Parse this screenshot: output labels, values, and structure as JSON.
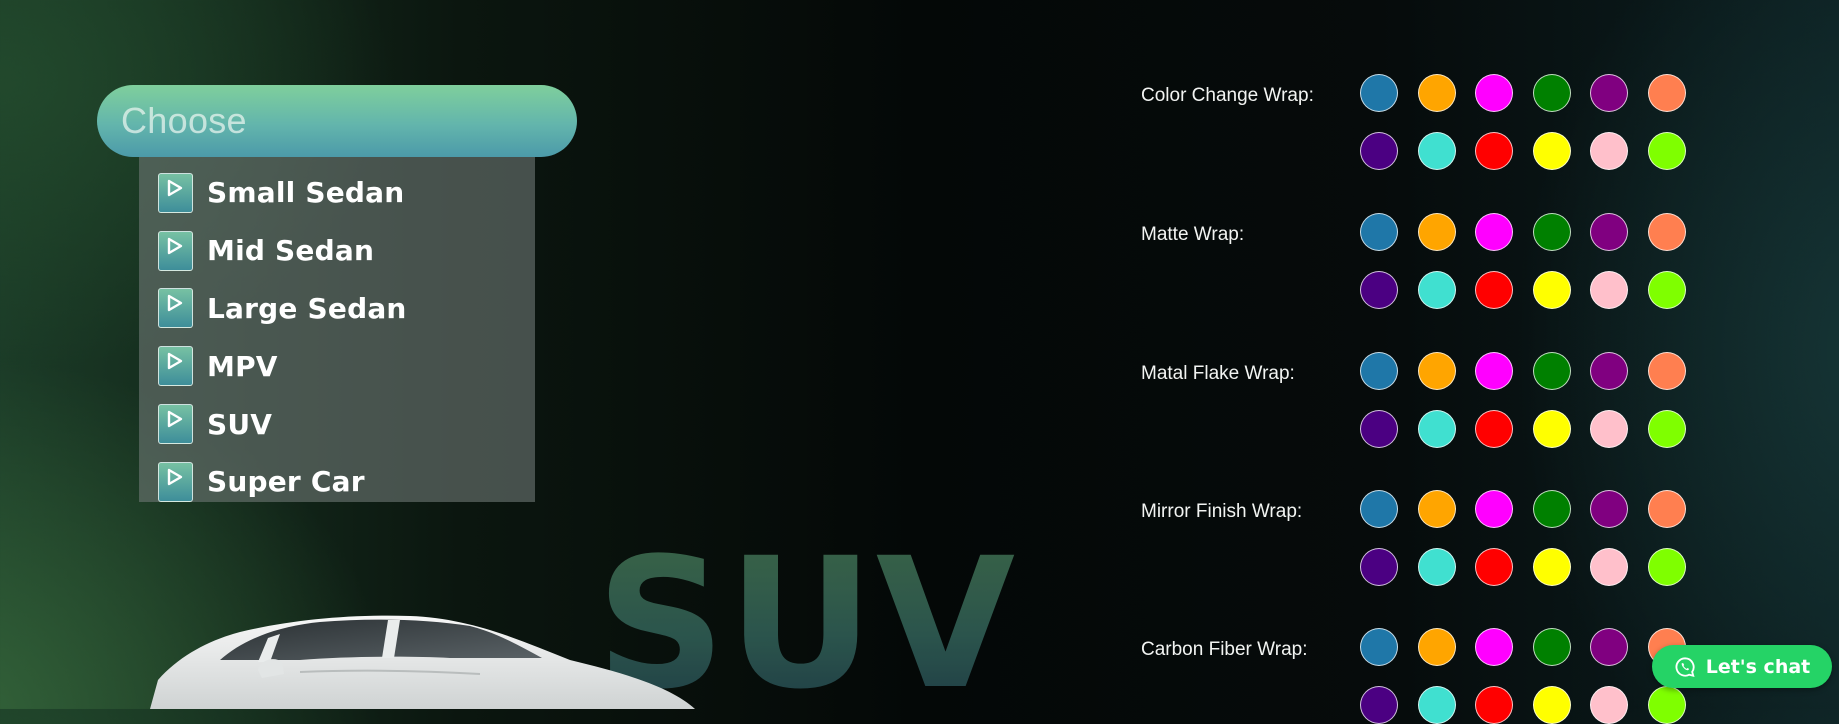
{
  "dropdown": {
    "placeholder": "Choose",
    "items": [
      {
        "label": "Small Sedan"
      },
      {
        "label": "Mid Sedan"
      },
      {
        "label": "Large Sedan"
      },
      {
        "label": "MPV"
      },
      {
        "label": "SUV"
      },
      {
        "label": "Super Car"
      }
    ],
    "item_icon": "play-icon"
  },
  "hero": {
    "big_label": "SUV"
  },
  "wraps": [
    {
      "label": "Color Change Wrap:"
    },
    {
      "label": "Matte Wrap:"
    },
    {
      "label": "Matal Flake Wrap:"
    },
    {
      "label": "Mirror Finish Wrap:"
    },
    {
      "label": "Carbon Fiber Wrap:"
    }
  ],
  "swatch_colors": [
    "#1f77a8",
    "#ffa500",
    "#ff00ff",
    "#008000",
    "#800080",
    "#ff7f50",
    "#4b0082",
    "#40e0d0",
    "#ff0000",
    "#ffff00",
    "#ffc0cb",
    "#7fff00"
  ],
  "chat": {
    "label": "Let's chat",
    "icon": "whatsapp-icon",
    "color": "#25d366"
  }
}
